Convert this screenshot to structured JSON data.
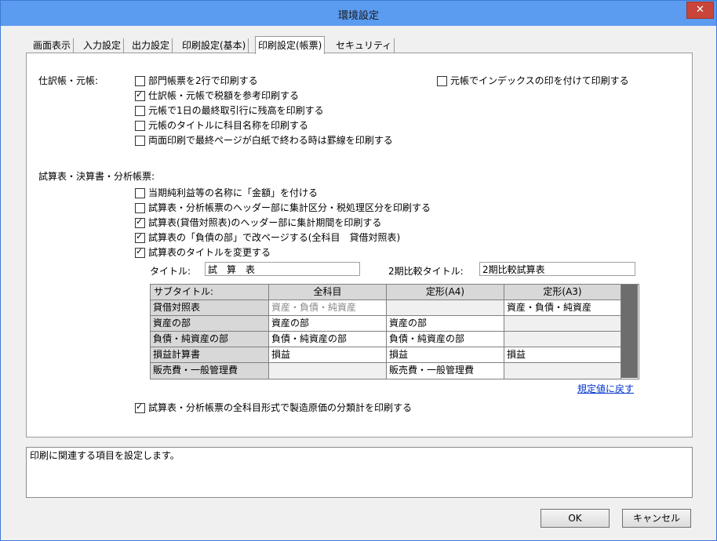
{
  "window": {
    "title": "環境設定",
    "close_glyph": "✕"
  },
  "tabs": [
    "画面表示",
    "入力設定",
    "出力設定",
    "印刷設定(基本)",
    "印刷設定(帳票)",
    "セキュリティ"
  ],
  "section1": {
    "label": "仕訳帳・元帳:",
    "options": [
      {
        "label": "部門帳票を2行で印刷する",
        "checked": false
      },
      {
        "label": "仕訳帳・元帳で税額を参考印刷する",
        "checked": true
      },
      {
        "label": "元帳で1日の最終取引行に残高を印刷する",
        "checked": false
      },
      {
        "label": "元帳のタイトルに科目名称を印刷する",
        "checked": false
      },
      {
        "label": "両面印刷で最終ページが白紙で終わる時は罫線を印刷する",
        "checked": false
      }
    ],
    "right_option": {
      "label": "元帳でインデックスの印を付けて印刷する",
      "checked": false
    }
  },
  "section2": {
    "label": "試算表・決算書・分析帳票:",
    "options": [
      {
        "label": "当期純利益等の名称に「金額」を付ける",
        "checked": false
      },
      {
        "label": "試算表・分析帳票のヘッダー部に集計区分・税処理区分を印刷する",
        "checked": false
      },
      {
        "label": "試算表(貸借対照表)のヘッダー部に集計期間を印刷する",
        "checked": true
      },
      {
        "label": "試算表の「負債の部」で改ページする(全科目　貸借対照表)",
        "checked": true
      },
      {
        "label": "試算表のタイトルを変更する",
        "checked": true
      }
    ],
    "title_label": "タイトル:",
    "title_value": "試　算　表",
    "compare_label": "2期比較タイトル:",
    "compare_value": "2期比較試算表",
    "grid": {
      "headers": [
        "サブタイトル:",
        "全科目",
        "定形(A4)",
        "定形(A3)"
      ],
      "rows": [
        [
          "貸借対照表",
          "資産・負債・純資産",
          "",
          "資産・負債・純資産"
        ],
        [
          "資産の部",
          "資産の部",
          "資産の部",
          ""
        ],
        [
          "負債・純資産の部",
          "負債・純資産の部",
          "負債・純資産の部",
          ""
        ],
        [
          "損益計算書",
          "損益",
          "損益",
          "損益"
        ],
        [
          "販売費・一般管理費",
          "",
          "販売費・一般管理費",
          ""
        ]
      ]
    },
    "reset_link": "規定値に戻す",
    "bottom_option": {
      "label": "試算表・分析帳票の全科目形式で製造原価の分類計を印刷する",
      "checked": true
    }
  },
  "description": "印刷に関連する項目を設定します。",
  "buttons": {
    "ok": "OK",
    "cancel": "キャンセル"
  }
}
